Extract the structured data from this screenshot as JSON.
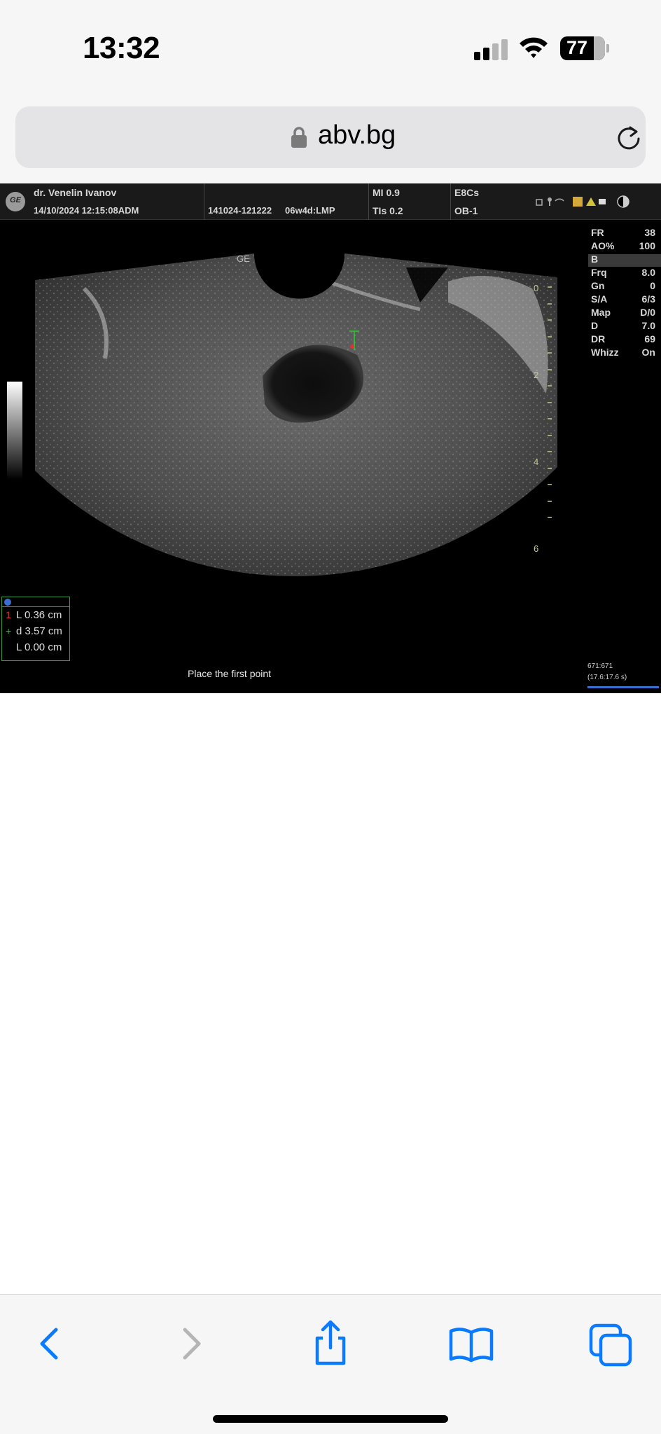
{
  "status_bar": {
    "time": "13:32",
    "battery_percent": "77",
    "signal_bars_active": 2,
    "signal_bars_total": 4
  },
  "browser": {
    "url": "abv.bg"
  },
  "ultrasound": {
    "header": {
      "doctor": "dr. Venelin Ivanov",
      "datetime": "14/10/2024 12:15:08ADM",
      "exam_id": "141024-121222",
      "gestation": "06w4d:LMP",
      "mi": "MI 0.9",
      "tis": "TIs 0.2",
      "probe": "E8Cs",
      "preset": "OB-1"
    },
    "brand_label": "GE",
    "params": [
      {
        "key": "FR",
        "value": "38"
      },
      {
        "key": "AO%",
        "value": "100"
      },
      {
        "key": "B",
        "value": ""
      },
      {
        "key": "Frq",
        "value": "8.0"
      },
      {
        "key": "Gn",
        "value": "0"
      },
      {
        "key": "S/A",
        "value": "6/3"
      },
      {
        "key": "Map",
        "value": "D/0"
      },
      {
        "key": "D",
        "value": "7.0"
      },
      {
        "key": "DR",
        "value": "69"
      },
      {
        "key": "Whizz",
        "value": "On"
      }
    ],
    "depth_labels": [
      "0",
      "2",
      "4",
      "6"
    ],
    "measurements": [
      {
        "symbol": "1",
        "text": "L 0.36 cm",
        "color": "#e03030"
      },
      {
        "symbol": "+",
        "text": "d 3.57 cm",
        "color": "#30c030"
      },
      {
        "symbol": "",
        "text": "L 0.00 cm",
        "color": "#dedede"
      }
    ],
    "prompt": "Place the first point",
    "frame_count": "671:671",
    "frame_time": "(17.6:17.6 s)"
  },
  "colors": {
    "ios_blue": "#0a7aff",
    "disabled_gray": "#b5b5b5"
  }
}
